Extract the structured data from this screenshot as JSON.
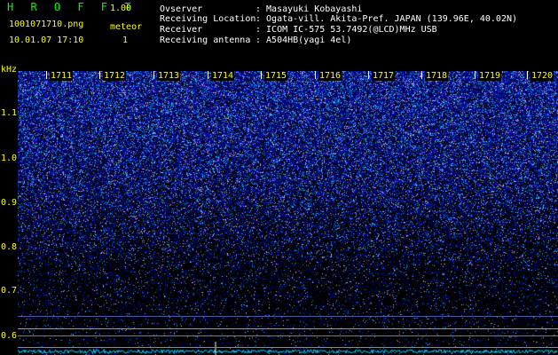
{
  "header": {
    "app_title": "H R O F F T",
    "app_version": "1.00",
    "file_name": "1001071710.png",
    "meteor_label": "meteor",
    "date_time": "10.01.07 17:10",
    "meteor_count": "1"
  },
  "info": [
    {
      "label": "Ovserver",
      "value": ": Masayuki Kobayashi"
    },
    {
      "label": "Receiving Location",
      "value": ": Ogata-vill. Akita-Pref. JAPAN (139.96E, 40.02N)"
    },
    {
      "label": "Receiver",
      "value": ": ICOM IC-575 53.7492(@LCD)MHz USB"
    },
    {
      "label": "Receiving antenna",
      "value": ": A504HB(yagi 4el)"
    }
  ],
  "y_axis": {
    "unit": "kHz",
    "ticks": [
      "1.1",
      "1.0",
      "0.9",
      "0.8",
      "0.7",
      "0.6"
    ]
  },
  "x_axis": {
    "ticks": [
      "1711",
      "1712",
      "1713",
      "1714",
      "1715",
      "1716",
      "1717",
      "1718",
      "1719",
      "1720"
    ]
  },
  "colors": {
    "background": "#000000",
    "title_green": "#00ff00",
    "label_yellow": "#ffff00",
    "signal_blue": "#1a3cff",
    "signal_cyan": "#00e0ff"
  }
}
